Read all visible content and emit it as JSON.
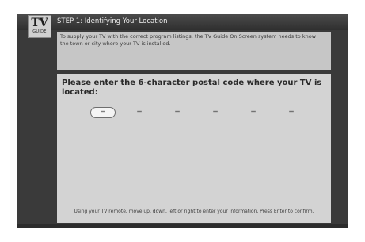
{
  "logo": {
    "tv": "TV",
    "guide": "GUIDE"
  },
  "header": {
    "step_title": "STEP 1: Identifying Your Location"
  },
  "intro": {
    "text": "To supply your TV with the correct program listings, the TV Guide On Screen system needs to know the town or city where your TV is installed."
  },
  "main": {
    "prompt": "Please enter the 6-character postal code where your TV is located:",
    "code_slots": [
      "=",
      "=",
      "=",
      "=",
      "=",
      "="
    ],
    "selected_slot": 0
  },
  "footer": {
    "instructions": "Using your TV remote, move up, down, left or right to enter your information. Press Enter to confirm."
  }
}
